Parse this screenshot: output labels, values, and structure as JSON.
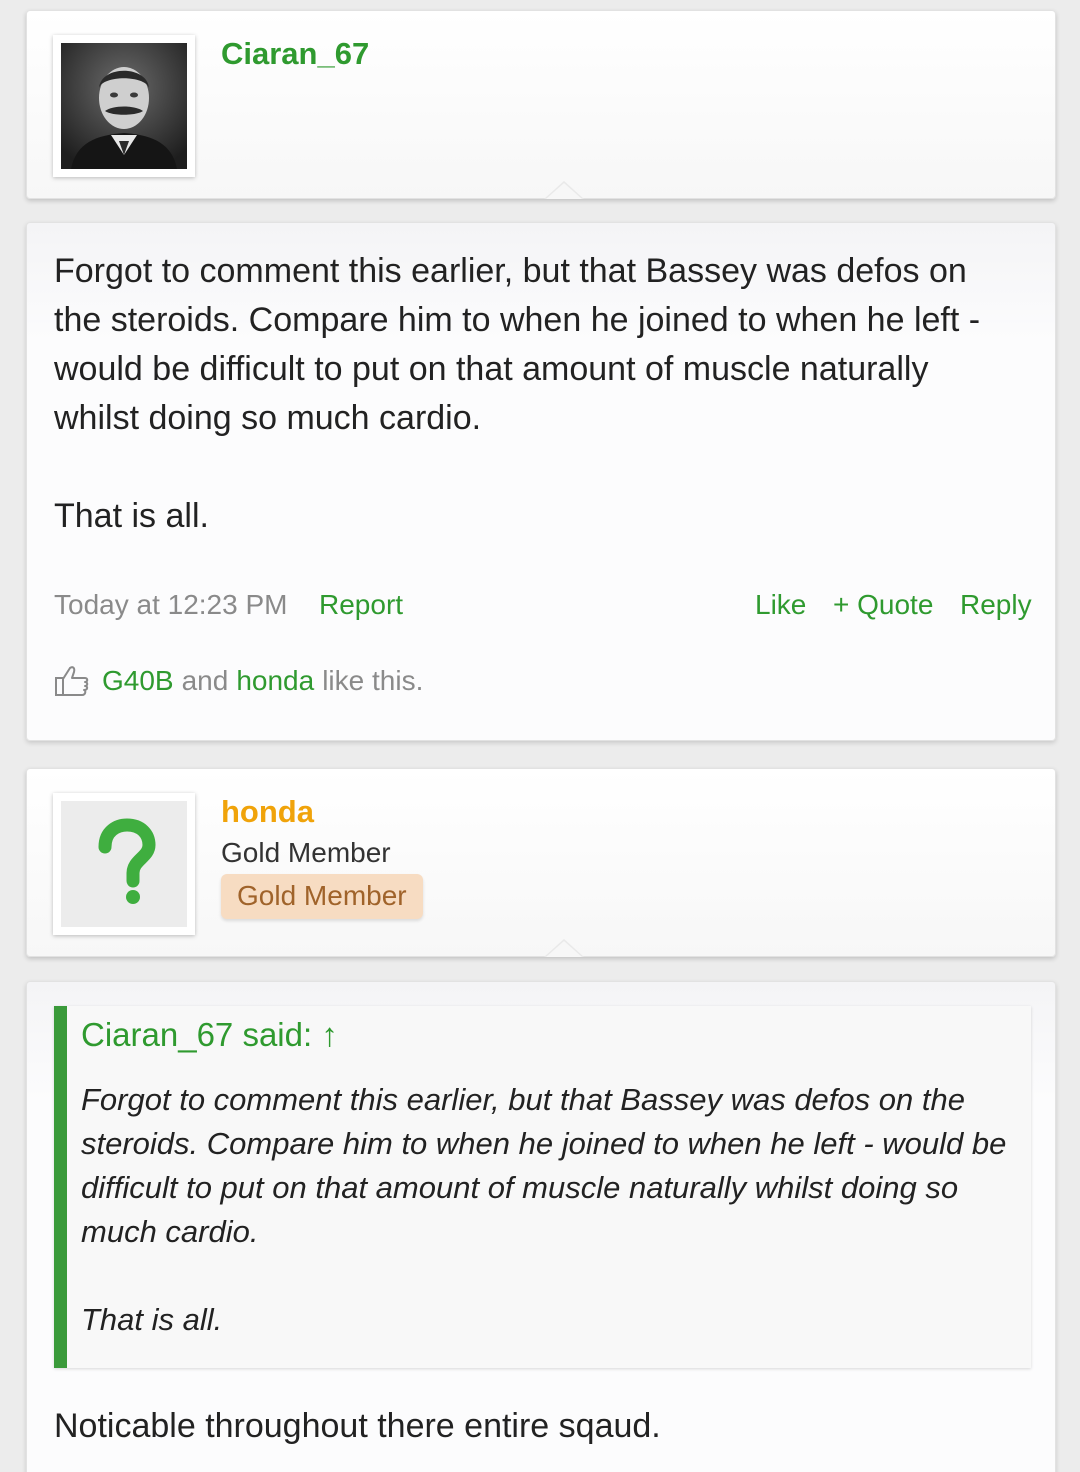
{
  "posts": [
    {
      "author": "Ciaran_67",
      "author_color": "#2f9a2f",
      "avatar": "portrait-photo",
      "body": "Forgot to comment this earlier, but that Bassey was defos on the steroids. Compare him to when he joined to when he left - would be difficult to put on that amount of muscle naturally whilst doing so much cardio.\n\nThat is all.",
      "timestamp": "Today at 12:23 PM",
      "report_label": "Report",
      "like_label": "Like",
      "quote_label": "+ Quote",
      "reply_label": "Reply",
      "likes": {
        "user1": "G40B",
        "and": "and",
        "user2": "honda",
        "suffix": "like this."
      }
    },
    {
      "author": "honda",
      "author_color": "#f0a30a",
      "avatar": "question-mark-icon",
      "user_title": "Gold Member",
      "user_badge": "Gold Member",
      "quote": {
        "header": "Ciaran_67 said: ↑",
        "body": "Forgot to comment this earlier, but that Bassey was defos on the steroids. Compare him to when he joined to when he left - would be difficult to put on that amount of muscle naturally whilst doing so much cardio.\n\nThat is all."
      },
      "body": "Noticable throughout there entire sqaud."
    }
  ]
}
